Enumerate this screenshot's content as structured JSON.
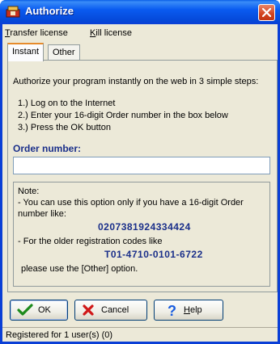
{
  "window": {
    "title": "Authorize"
  },
  "menu": {
    "transfer_prefix": "T",
    "transfer_rest": "ransfer license",
    "kill_prefix": "K",
    "kill_rest": "ill license"
  },
  "tabs": [
    {
      "label": "Instant"
    },
    {
      "label": "Other"
    }
  ],
  "instant": {
    "intro": "Authorize your program instantly on the web in 3 simple steps:",
    "steps": [
      "1.) Log on to the Internet",
      "2.) Enter your 16-digit Order number in the box below",
      "3.) Press the OK button"
    ],
    "order_label": "Order number:",
    "order_value": "",
    "note": {
      "title": "Note:",
      "line1": "- You can use this option only if you have a 16-digit Order",
      "line2": "number like:",
      "example_order": "0207381924334424",
      "line3": "- For the older registration codes like",
      "example_code": "T01-4710-0101-6722",
      "line4": "please use the [Other] option."
    }
  },
  "buttons": {
    "ok": "OK",
    "cancel": "Cancel",
    "help_prefix": "H",
    "help_rest": "elp"
  },
  "status": {
    "text": "Registered for 1 user(s) (0)"
  },
  "colors": {
    "title_bar": "#0a5bf0",
    "accent_text": "#1a2f8a"
  }
}
